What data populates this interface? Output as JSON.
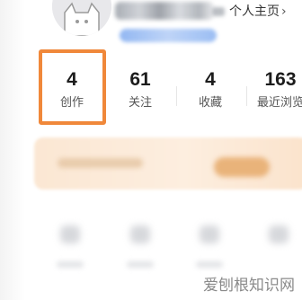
{
  "header": {
    "homepage_link": "个人主页",
    "chevron": "›"
  },
  "stats": [
    {
      "value": "4",
      "label": "创作"
    },
    {
      "value": "61",
      "label": "关注"
    },
    {
      "value": "4",
      "label": "收藏"
    },
    {
      "value": "163",
      "label": "最近浏览"
    }
  ],
  "highlight": {
    "target": "stats.0",
    "color": "#f0883a"
  },
  "icons": {
    "avatar": "cat-avatar-icon",
    "chevron": "chevron-right-icon"
  },
  "watermark": {
    "text": "爱刨根知识网"
  }
}
